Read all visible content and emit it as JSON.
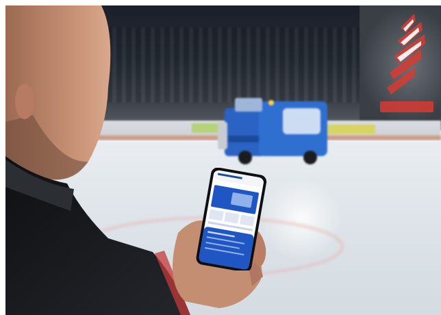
{
  "scene": {
    "subject": "person",
    "device": "smartphone",
    "background_vehicle": "ice-resurfacer",
    "setting": "ice-rink"
  },
  "phone_screen": {
    "header_text": "",
    "accent_color": "#1f56c4",
    "background_color": "#ffffff"
  },
  "colors": {
    "ice": "#e3e8ed",
    "resurfacer_body": "#2f6fd0",
    "jacket": "#17191d",
    "board_stripe": "#d96a3a",
    "banner_logo": "#d73b32"
  }
}
